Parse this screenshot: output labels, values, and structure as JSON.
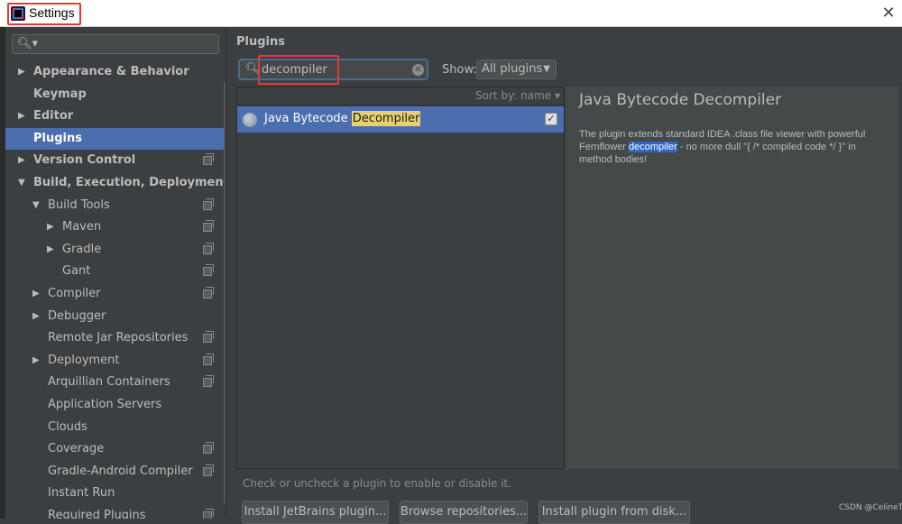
{
  "window": {
    "title": "Settings",
    "close_glyph": "✕"
  },
  "sidebar": {
    "search_placeholder": "",
    "items": [
      {
        "label": "Appearance & Behavior",
        "arrow": "▶",
        "bold": true,
        "project": false
      },
      {
        "label": "Keymap",
        "arrow": "",
        "bold": true,
        "project": false
      },
      {
        "label": "Editor",
        "arrow": "▶",
        "bold": true,
        "project": false
      },
      {
        "label": "Plugins",
        "arrow": "",
        "bold": true,
        "project": false,
        "selected": true
      },
      {
        "label": "Version Control",
        "arrow": "▶",
        "bold": true,
        "project": true
      },
      {
        "label": "Build, Execution, Deployment",
        "arrow": "▼",
        "bold": true,
        "project": false
      },
      {
        "label": "Build Tools",
        "arrow": "▼",
        "bold": false,
        "project": true
      },
      {
        "label": "Maven",
        "arrow": "▶",
        "bold": false,
        "project": true
      },
      {
        "label": "Gradle",
        "arrow": "▶",
        "bold": false,
        "project": true
      },
      {
        "label": "Gant",
        "arrow": "",
        "bold": false,
        "project": true
      },
      {
        "label": "Compiler",
        "arrow": "▶",
        "bold": false,
        "project": true
      },
      {
        "label": "Debugger",
        "arrow": "▶",
        "bold": false,
        "project": false
      },
      {
        "label": "Remote Jar Repositories",
        "arrow": "",
        "bold": false,
        "project": true
      },
      {
        "label": "Deployment",
        "arrow": "▶",
        "bold": false,
        "project": true
      },
      {
        "label": "Arquillian Containers",
        "arrow": "",
        "bold": false,
        "project": true
      },
      {
        "label": "Application Servers",
        "arrow": "",
        "bold": false,
        "project": false
      },
      {
        "label": "Clouds",
        "arrow": "",
        "bold": false,
        "project": false
      },
      {
        "label": "Coverage",
        "arrow": "",
        "bold": false,
        "project": true
      },
      {
        "label": "Gradle-Android Compiler",
        "arrow": "",
        "bold": false,
        "project": true
      },
      {
        "label": "Instant Run",
        "arrow": "",
        "bold": false,
        "project": false
      },
      {
        "label": "Required Plugins",
        "arrow": "",
        "bold": false,
        "project": true
      }
    ]
  },
  "plugins": {
    "title": "Plugins",
    "search_value": "decompiler",
    "show_label": "Show:",
    "show_selected": "All plugins",
    "sort_label": "Sort by: name ▾",
    "list": [
      {
        "name_prefix": "Java Bytecode ",
        "name_match": "Decompiler",
        "enabled": true
      }
    ],
    "detail": {
      "title": "Java Bytecode Decompiler",
      "desc_before": "The plugin extends standard IDEA .class file viewer with powerful Fernflower ",
      "desc_match": "decompiler",
      "desc_after": " - no more dull \"{ /* compiled code */ }\" in method bodies!"
    },
    "hint": "Check or uncheck a plugin to enable or disable it.",
    "buttons": {
      "install_jetbrains": "Install JetBrains plugin...",
      "browse_repos": "Browse repositories...",
      "install_disk": "Install plugin from disk..."
    }
  },
  "watermark": "CSDN @CelineT",
  "colors": {
    "accent": "#4b6eaf",
    "highlight_box": "#e53935",
    "match_bg": "#e8cf72"
  },
  "icons": [
    "search-icon",
    "close-icon",
    "chevron-right-icon",
    "chevron-down-icon",
    "project-icon",
    "plugin-icon",
    "checkbox-icon"
  ]
}
